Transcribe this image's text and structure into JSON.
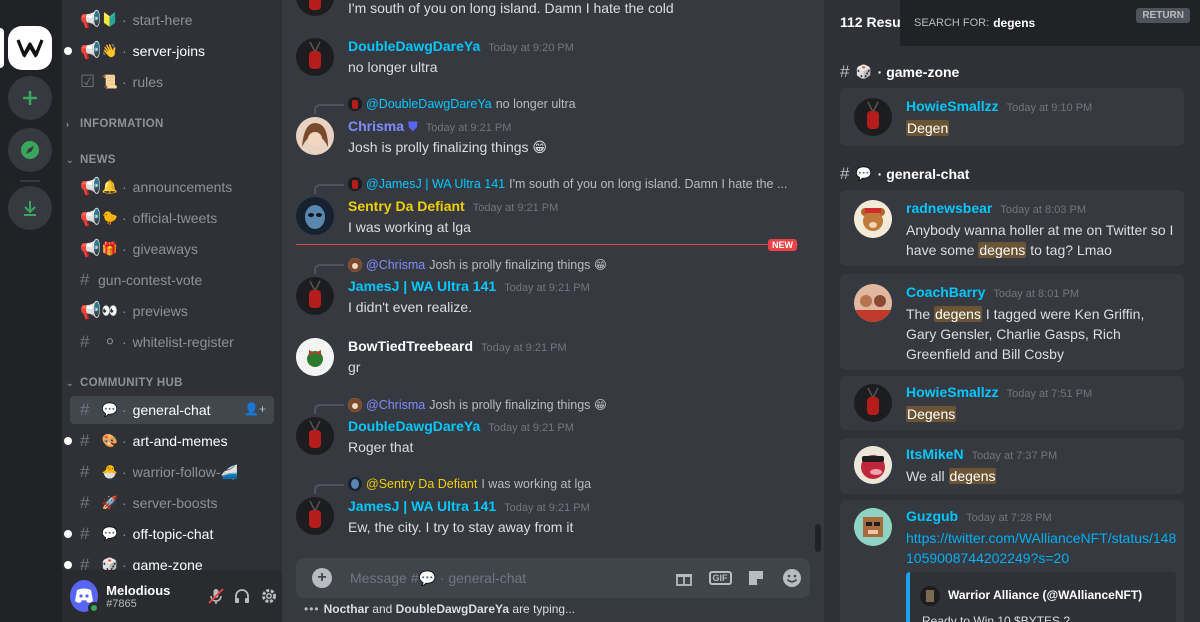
{
  "colors": {
    "accent_cyan": "#00c8ff",
    "gold": "#f0d000",
    "purple": "#7f8cff",
    "unread_red": "#ed4245",
    "highlight": "#6b5434"
  },
  "servers": [
    {
      "name": "WA server logo",
      "icon": "wa-logo-icon"
    },
    {
      "name": "Add a Server",
      "icon": "plus-icon"
    },
    {
      "name": "Explore Public Servers",
      "icon": "compass-icon"
    },
    {
      "name": "Download Apps",
      "icon": "download-icon"
    }
  ],
  "sidebar": {
    "channels_top": [
      {
        "emoji": "🔰",
        "label": "start-here"
      },
      {
        "emoji": "👋",
        "label": "server-joins"
      },
      {
        "emoji": "📜",
        "label": "rules"
      }
    ],
    "categories": {
      "information": "INFORMATION",
      "news": "NEWS",
      "community": "COMMUNITY HUB"
    },
    "news": [
      {
        "emoji": "🔔",
        "label": "announcements"
      },
      {
        "emoji": "🐤",
        "label": "official-tweets"
      },
      {
        "emoji": "🎁",
        "label": "giveaways"
      },
      {
        "emoji": "",
        "label": "gun-contest-vote"
      },
      {
        "emoji": "👀",
        "label": "previews"
      },
      {
        "emoji": "⚪",
        "label": "whitelist-register"
      }
    ],
    "community": [
      {
        "emoji": "💬",
        "label": "general-chat"
      },
      {
        "emoji": "🎨",
        "label": "art-and-memes"
      },
      {
        "emoji": "🐣",
        "label": "warrior-follow-🚄"
      },
      {
        "emoji": "🚀",
        "label": "server-boosts"
      },
      {
        "emoji": "💬",
        "label": "off-topic-chat"
      },
      {
        "emoji": "🎲",
        "label": "game-zone"
      }
    ]
  },
  "user": {
    "name": "Melodious",
    "tag": "#7865"
  },
  "chat": {
    "messages": [
      {
        "text": "I'm south of you on long island. Damn I hate the cold"
      },
      {
        "author": "DoubleDawgDareYa",
        "time": "Today at 9:20 PM",
        "text": "no longer ultra"
      },
      {
        "reply_to": "@DoubleDawgDareYa",
        "reply_text": "no longer ultra",
        "author": "Chrisma",
        "time": "Today at 9:21 PM",
        "text": "Josh is prolly finalizing things 😁"
      },
      {
        "reply_to": "@JamesJ | WA Ultra 141",
        "reply_text": "I'm south of you on long island. Damn I hate the ...",
        "author": "Sentry Da Defiant",
        "time": "Today at 9:21 PM",
        "text": "I was working at lga"
      },
      {
        "reply_to": "@Chrisma",
        "reply_text": "Josh is prolly finalizing things 😁",
        "author": "JamesJ | WA Ultra 141",
        "time": "Today at 9:21 PM",
        "text": "I didn't even realize."
      },
      {
        "author": "BowTiedTreebeard",
        "time": "Today at 9:21 PM",
        "text": "gr"
      },
      {
        "reply_to": "@Chrisma",
        "reply_text": "Josh is prolly finalizing things 😁",
        "author": "DoubleDawgDareYa",
        "time": "Today at 9:21 PM",
        "text": "Roger that"
      },
      {
        "reply_to": "@Sentry Da Defiant",
        "reply_text": "I was working at lga",
        "author": "JamesJ | WA Ultra 141",
        "time": "Today at 9:21 PM",
        "text": "Ew, the city. I try to stay away from it"
      }
    ],
    "new_badge": "NEW",
    "composer_placeholder": "Message #💬 · general-chat",
    "typing": {
      "user1": "Nocthar",
      "and": "and",
      "user2": "DoubleDawgDareYa",
      "suffix": "are typing..."
    }
  },
  "search": {
    "count": "112 Result",
    "search_for_label": "SEARCH FOR:",
    "query": "degens",
    "return_label": "RETURN",
    "group1": "game-zone",
    "group2": "general-chat",
    "results": [
      {
        "author": "HowieSmallzz",
        "time": "Today at 9:10 PM",
        "pre": "",
        "hl": "Degen",
        "post": ""
      },
      {
        "author": "radnewsbear",
        "time": "Today at 8:03 PM",
        "pre": "Anybody wanna holler at me on Twitter so I have some ",
        "hl": "degens",
        "post": " to tag? Lmao"
      },
      {
        "author": "CoachBarry",
        "time": "Today at 8:01 PM",
        "pre": "The ",
        "hl": "degens",
        "post": " I tagged were Ken Griffin, Gary Gensler, Charlie Gasps, Rich Greenfield and Bill Cosby"
      },
      {
        "author": "HowieSmallzz",
        "time": "Today at 7:51 PM",
        "pre": "",
        "hl": "Degens",
        "post": ""
      },
      {
        "author": "ItsMikeN",
        "time": "Today at 7:37 PM",
        "pre": "We all ",
        "hl": "degens",
        "post": ""
      },
      {
        "author": "Guzgub",
        "time": "Today at 7:28 PM",
        "link": "https://twitter.com/WAllianceNFT/status/1481059008744202249?s=20",
        "embed_author": "Warrior Alliance (@WAllianceNFT)",
        "embed_text": "Ready to Win 10 $BYTES ?"
      }
    ]
  }
}
